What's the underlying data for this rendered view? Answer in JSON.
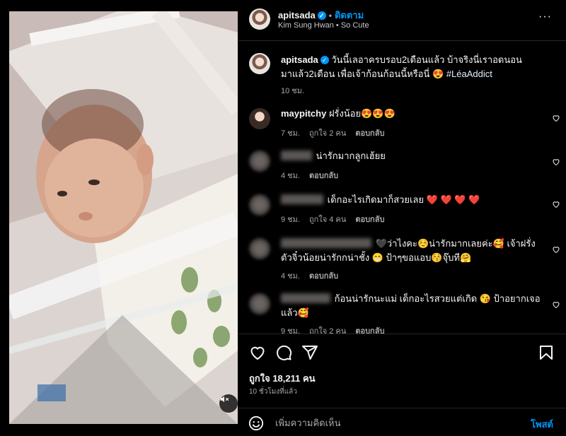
{
  "post": {
    "username": "apitsada",
    "follow_label": "ติดตาม",
    "dot": "•",
    "subtitle": "Kim Sung Hwan • So Cute",
    "more_glyph": "···"
  },
  "caption": {
    "username": "apitsada",
    "text": "วันนี้เลอาครบรอบ2เดือนแล้ว บ้าจริงนี่เราอดนอนมาแล้ว2เดือน เพื่อเจ้าก้อนก้อนนี้หรือนี่ 😍",
    "hashtag": "#LéaAddict",
    "time": "10 ชม."
  },
  "comments": [
    {
      "username": "maypitchy",
      "text": "ฝรั่งน้อย😍😍😍",
      "time": "7 ชม.",
      "likes": "ถูกใจ 2 คน",
      "reply": "ตอบกลับ"
    },
    {
      "username": "",
      "text": "น่ารักมากลูกเฮ้ยย",
      "time": "4 ชม.",
      "likes": "",
      "reply": "ตอบกลับ"
    },
    {
      "username": "",
      "text": "เด็กอะไรเกิดมาก็สวยเลย ❤️ ❤️ ❤️ ❤️",
      "time": "9 ชม.",
      "likes": "ถูกใจ 4 คน",
      "reply": "ตอบกลับ"
    },
    {
      "username": "",
      "text": "🖤ว่าไงคะ☺️น่ารักมากเลยค่ะ🥰 เจ้าฝรั่งตัวจิ๋วน้อยน่ารักกน่าชั้ง 😁 ป้าๆขอแอบ😚จุ๊บที🤗",
      "time": "4 ชม.",
      "likes": "",
      "reply": "ตอบกลับ"
    },
    {
      "username": "",
      "text": "ก้อนน่ารักนะแม่ เด็กอะไรสวยแต่เกิด 😘 ป้าอยากเจอแล้ว🥰",
      "time": "9 ชม.",
      "likes": "ถูกใจ 2 คน",
      "reply": "ตอบกลับ"
    }
  ],
  "footer": {
    "likes_text": "ถูกใจ 18,211 คน",
    "time_ago": "10 ชั่วโมงที่แล้ว",
    "comment_placeholder": "เพิ่มความคิดเห็น",
    "post_label": "โพสต์"
  },
  "icons": {
    "verified": "✓",
    "mute": "speaker-muted-icon",
    "heart": "heart-icon",
    "comment": "comment-icon",
    "share": "share-icon",
    "save": "bookmark-icon",
    "emoji": "emoji-icon"
  },
  "colors": {
    "accent": "#0095f6",
    "background": "#000000",
    "muted_text": "#a8a8a8"
  }
}
